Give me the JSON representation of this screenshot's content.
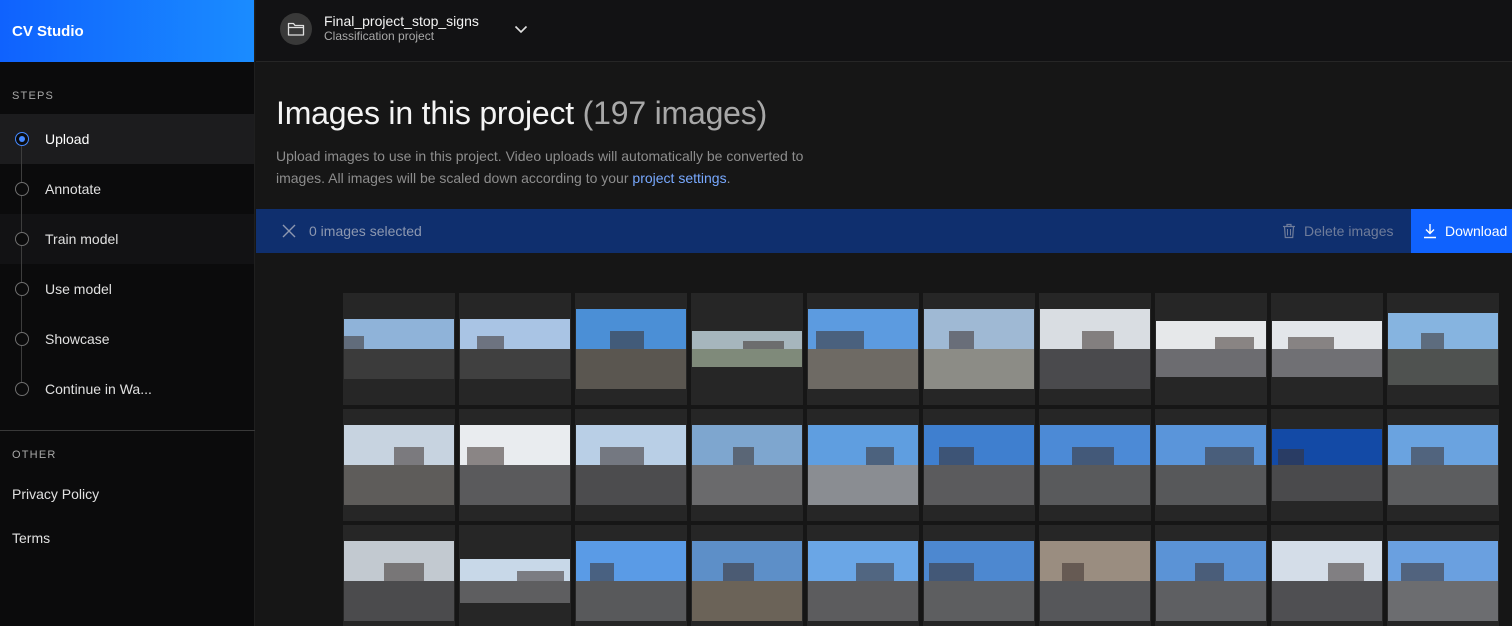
{
  "sidebar": {
    "brand": "CV Studio",
    "steps_label": "STEPS",
    "steps": [
      {
        "label": "Upload",
        "active": true
      },
      {
        "label": "Annotate",
        "active": false
      },
      {
        "label": "Train model",
        "active": false
      },
      {
        "label": "Use model",
        "active": false
      },
      {
        "label": "Showcase",
        "active": false
      },
      {
        "label": "Continue in Wa...",
        "active": false
      }
    ],
    "other_label": "OTHER",
    "links": [
      "Privacy Policy",
      "Terms"
    ]
  },
  "header": {
    "project_name": "Final_project_stop_signs",
    "project_type": "Classification project"
  },
  "main": {
    "title": "Images in this project",
    "count": "(197 images)",
    "description": "Upload images to use in this project. Video uploads will automatically be converted to images. All images will be scaled down according to your ",
    "settings_link": "project settings",
    "settings_link_suffix": "."
  },
  "selection": {
    "selected_text": "0 images selected",
    "delete_label": "Delete images",
    "download_label": "Download"
  },
  "thumbnails": [
    {
      "sky": "#8fb3d9",
      "ground": "#3b3b3b",
      "h": 60
    },
    {
      "sky": "#a9c4e4",
      "ground": "#404040",
      "h": 60
    },
    {
      "sky": "#4b8fd6",
      "ground": "#5a5650",
      "h": 80
    },
    {
      "sky": "#a6b6bd",
      "ground": "#7f8a7a",
      "h": 36
    },
    {
      "sky": "#5c9be0",
      "ground": "#6e6a64",
      "h": 80
    },
    {
      "sky": "#9fb9d4",
      "ground": "#8c8c86",
      "h": 80
    },
    {
      "sky": "#d9dde2",
      "ground": "#4a4a4d",
      "h": 80
    },
    {
      "sky": "#e6e8ea",
      "ground": "#6c6c70",
      "h": 56
    },
    {
      "sky": "#e3e6ea",
      "ground": "#707074",
      "h": 56
    },
    {
      "sky": "#86b4e0",
      "ground": "#4f5250",
      "h": 72
    },
    {
      "sky": "#c7d3e0",
      "ground": "#5e5c5a",
      "h": 80
    },
    {
      "sky": "#e9ecef",
      "ground": "#5a5a5c",
      "h": 80
    },
    {
      "sky": "#b9cfe6",
      "ground": "#4c4c4e",
      "h": 80
    },
    {
      "sky": "#7ea6cf",
      "ground": "#6a6a6c",
      "h": 80
    },
    {
      "sky": "#5f9ee0",
      "ground": "#8a8d92",
      "h": 80
    },
    {
      "sky": "#3f7fcf",
      "ground": "#5b5b5d",
      "h": 80
    },
    {
      "sky": "#4c8ad6",
      "ground": "#595a5c",
      "h": 80
    },
    {
      "sky": "#5a95da",
      "ground": "#57585a",
      "h": 80
    },
    {
      "sky": "#134aa6",
      "ground": "#4a4a4c",
      "h": 72
    },
    {
      "sky": "#6aa3e0",
      "ground": "#5c5d5f",
      "h": 80
    },
    {
      "sky": "#c2c9d0",
      "ground": "#4b4b4d",
      "h": 80
    },
    {
      "sky": "#c8d8e8",
      "ground": "#5e5e60",
      "h": 44
    },
    {
      "sky": "#5a9be6",
      "ground": "#58595b",
      "h": 80
    },
    {
      "sky": "#5d8fc8",
      "ground": "#6b6358",
      "h": 80
    },
    {
      "sky": "#6aa6e6",
      "ground": "#5c5c5e",
      "h": 80
    },
    {
      "sky": "#4d88d0",
      "ground": "#5d5e60",
      "h": 80
    },
    {
      "sky": "#9a8d80",
      "ground": "#56575a",
      "h": 80
    },
    {
      "sky": "#5b93d6",
      "ground": "#5e5f62",
      "h": 80
    },
    {
      "sky": "#d4dde8",
      "ground": "#4f4f52",
      "h": 80
    },
    {
      "sky": "#6aa0e0",
      "ground": "#6c6d70",
      "h": 80
    }
  ]
}
